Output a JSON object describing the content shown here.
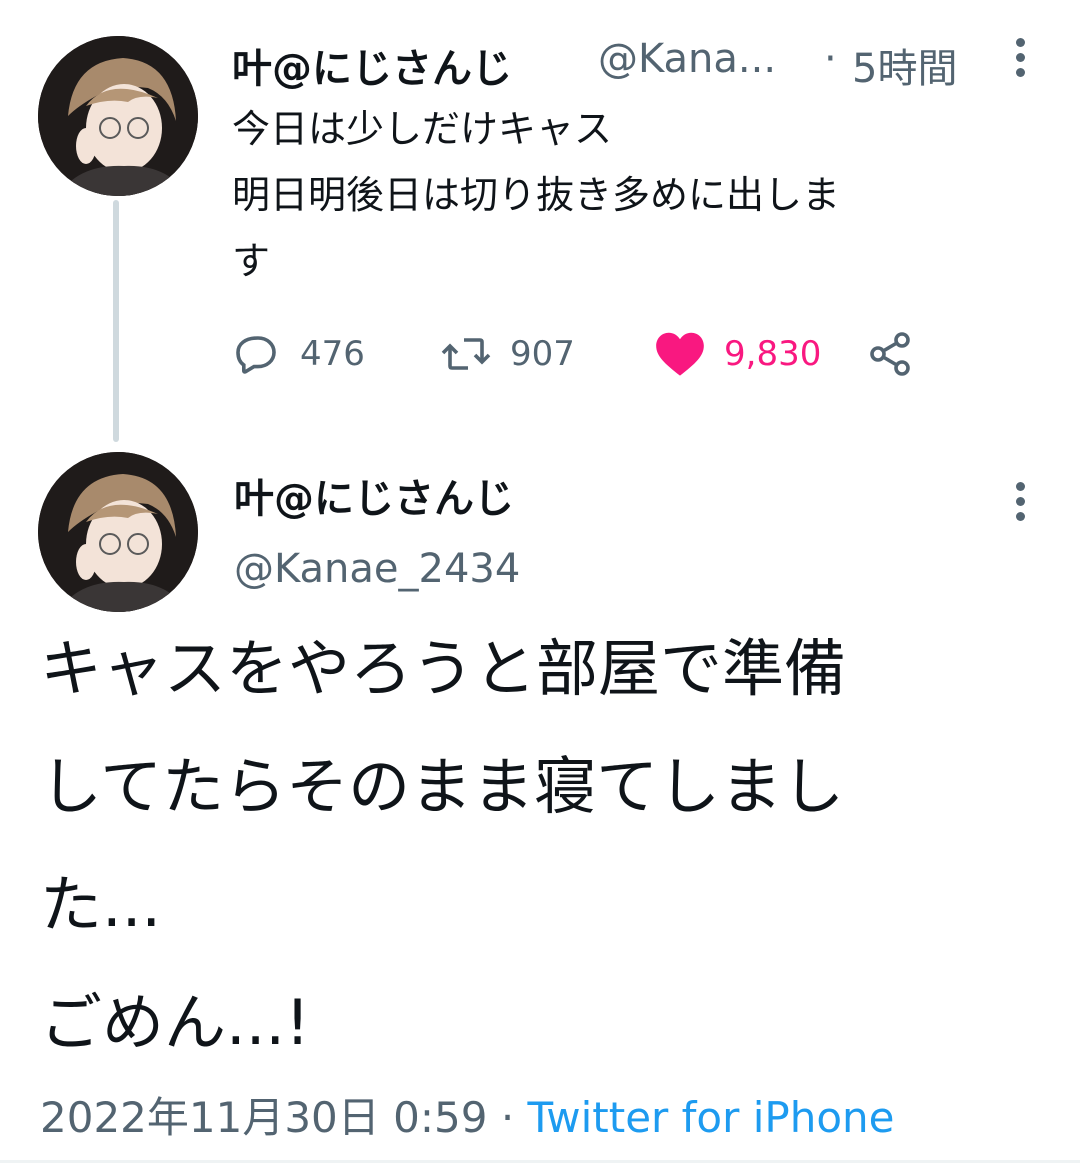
{
  "parent_tweet": {
    "display_name": "叶@にじさんじ",
    "handle": "@Kana...",
    "separator": "·",
    "time": "5時間",
    "text_lines": [
      "今日は少しだけキャス",
      "明日明後日は切り抜き多めに出しま",
      "す"
    ],
    "replies": "476",
    "retweets": "907",
    "likes": "9,830",
    "liked": true
  },
  "main_tweet": {
    "display_name": "叶@にじさんじ",
    "handle": "@Kanae_2434",
    "text_lines": [
      "キャスをやろうと部屋で準備",
      "してたらそのまま寝てしまし",
      "た...",
      "ごめん...!"
    ],
    "timestamp": "2022年11月30日 0:59",
    "separator": "·",
    "source": "Twitter for iPhone"
  },
  "icons": {
    "reply": "reply-icon",
    "retweet": "retweet-icon",
    "like": "heart-icon",
    "share": "share-icon",
    "more": "more-vertical-icon"
  },
  "colors": {
    "text": "#0f1419",
    "secondary": "#536471",
    "like": "#f91880",
    "link": "#1d9bf0",
    "thread_line": "#cfd9de"
  }
}
